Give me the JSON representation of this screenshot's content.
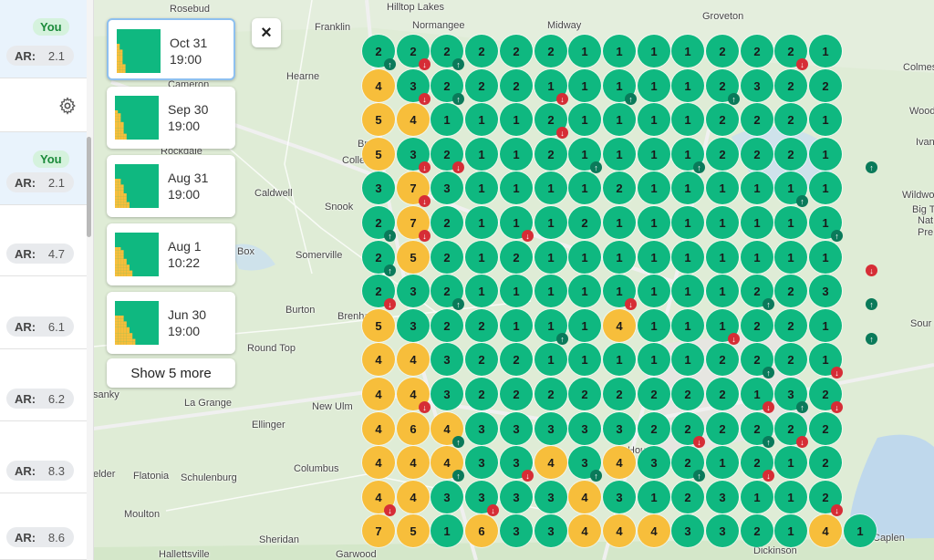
{
  "left_panel": {
    "rows": [
      {
        "you": true,
        "you_label": "You",
        "ar_label": "AR:",
        "ar_value": "2.1"
      },
      {
        "you": false,
        "settings": true
      },
      {
        "you": true,
        "you_label": "You",
        "ar_label": "AR:",
        "ar_value": "2.1"
      },
      {
        "you": false,
        "ar_label": "AR:",
        "ar_value": "4.7"
      },
      {
        "you": false,
        "ar_label": "AR:",
        "ar_value": "6.1"
      },
      {
        "you": false,
        "ar_label": "AR:",
        "ar_value": "6.2"
      },
      {
        "you": false,
        "ar_label": "AR:",
        "ar_value": "8.3"
      },
      {
        "you": false,
        "ar_label": "AR:",
        "ar_value": "8.6"
      }
    ]
  },
  "snapshots": [
    {
      "date": "Oct 31",
      "time": "19:00",
      "selected": true
    },
    {
      "date": "Sep 30",
      "time": "19:00",
      "selected": false
    },
    {
      "date": "Aug 31",
      "time": "19:00",
      "selected": false
    },
    {
      "date": "Aug 1",
      "time": "10:22",
      "selected": false
    },
    {
      "date": "Jun 30",
      "time": "19:00",
      "selected": false
    }
  ],
  "show_more_label": "Show 5 more",
  "close_icon": "×",
  "colors": {
    "good": "#0fb880",
    "mid": "#f7be3b",
    "up": "#0a7a5a",
    "down": "#d62d36"
  },
  "map_places": {
    "rosebud": "Rosebud",
    "hilltop": "Hilltop Lakes",
    "normangee": "Normangee",
    "midway": "Midway",
    "groveton": "Groveton",
    "franklin": "Franklin",
    "hearne": "Hearne",
    "cameron": "Cameron",
    "colmes": "Colmes",
    "wood": "Wood",
    "caldwell": "Caldwell",
    "snook": "Snook",
    "ivanh": "Ivanh",
    "wildwood": "Wildwood",
    "bigt": "Big T",
    "somerville": "Somerville",
    "box": "Box",
    "burton": "Burton",
    "brenham": "Brenha",
    "round_top": "Round Top",
    "sour": "Sour L",
    "sanky": "sanky",
    "la_grange": "La Grange",
    "new_ulm": "New Ulm",
    "ellinger": "Ellinger",
    "elder": "elder",
    "flatonia": "Flatonia",
    "schulenburg": "Schulenburg",
    "columbus": "Columbus",
    "moulton": "Moulton",
    "sheridan": "Sheridan",
    "hallettsville": "Hallettsville",
    "garwood": "Garwood",
    "dickinson": "Dickinson",
    "caplen": "Caplen",
    "rockdale": "Rockdale",
    "colle": "Colle",
    "bry": "Bry",
    "nat": "Nat",
    "pre": "Pre",
    "houston": "Housto"
  },
  "grid": {
    "rows": [
      [
        "2",
        "2",
        "2",
        "2",
        "2",
        "2",
        "1",
        "1",
        "1",
        "1",
        "2",
        "2",
        "2",
        "1"
      ],
      [
        "4",
        "3",
        "2",
        "2",
        "2",
        "1",
        "1",
        "1",
        "1",
        "1",
        "2",
        "3",
        "2",
        "2"
      ],
      [
        "5",
        "4",
        "1",
        "1",
        "1",
        "2",
        "1",
        "1",
        "1",
        "1",
        "2",
        "2",
        "2",
        "1"
      ],
      [
        "5",
        "3",
        "2",
        "1",
        "1",
        "2",
        "1",
        "1",
        "1",
        "1",
        "2",
        "2",
        "2",
        "1"
      ],
      [
        "3",
        "7",
        "3",
        "1",
        "1",
        "1",
        "1",
        "2",
        "1",
        "1",
        "1",
        "1",
        "1",
        "1"
      ],
      [
        "2",
        "7",
        "2",
        "1",
        "1",
        "1",
        "2",
        "1",
        "1",
        "1",
        "1",
        "1",
        "1",
        "1"
      ],
      [
        "2",
        "5",
        "2",
        "1",
        "2",
        "1",
        "1",
        "1",
        "1",
        "1",
        "1",
        "1",
        "1",
        "1"
      ],
      [
        "2",
        "3",
        "2",
        "1",
        "1",
        "1",
        "1",
        "1",
        "1",
        "1",
        "1",
        "2",
        "2",
        "3"
      ],
      [
        "5",
        "3",
        "2",
        "2",
        "1",
        "1",
        "1",
        "4",
        "1",
        "1",
        "1",
        "2",
        "2",
        "1"
      ],
      [
        "4",
        "4",
        "3",
        "2",
        "2",
        "1",
        "1",
        "1",
        "1",
        "1",
        "2",
        "2",
        "2",
        "1"
      ],
      [
        "4",
        "4",
        "3",
        "2",
        "2",
        "2",
        "2",
        "2",
        "2",
        "2",
        "2",
        "1",
        "3",
        "2"
      ],
      [
        "4",
        "6",
        "4",
        "3",
        "3",
        "3",
        "3",
        "3",
        "2",
        "2",
        "2",
        "2",
        "2",
        "2"
      ],
      [
        "4",
        "4",
        "4",
        "3",
        "3",
        "4",
        "3",
        "4",
        "3",
        "2",
        "1",
        "2",
        "1",
        "2"
      ],
      [
        "4",
        "4",
        "3",
        "3",
        "3",
        "3",
        "4",
        "3",
        "1",
        "2",
        "3",
        "1",
        "1",
        "2"
      ],
      [
        "7",
        "5",
        "1",
        "6",
        "3",
        "3",
        "4",
        "4",
        "4",
        "3",
        "3",
        "2",
        "1",
        "4",
        "1"
      ]
    ],
    "arrows": [
      {
        "row": 0,
        "col": 0,
        "dir": "up"
      },
      {
        "row": 0,
        "col": 2,
        "dir": "up"
      },
      {
        "row": 0,
        "col": 1,
        "dir": "dn"
      },
      {
        "row": 0,
        "col": 12,
        "dir": "dn"
      },
      {
        "row": 1,
        "col": 1,
        "dir": "dn"
      },
      {
        "row": 1,
        "col": 2,
        "dir": "up"
      },
      {
        "row": 1,
        "col": 5,
        "dir": "dn"
      },
      {
        "row": 1,
        "col": 7,
        "dir": "up"
      },
      {
        "row": 1,
        "col": 10,
        "dir": "up"
      },
      {
        "row": 2,
        "col": 5,
        "dir": "dn"
      },
      {
        "row": 3,
        "col": 1,
        "dir": "dn"
      },
      {
        "row": 3,
        "col": 2,
        "dir": "dn"
      },
      {
        "row": 3,
        "col": 6,
        "dir": "up"
      },
      {
        "row": 3,
        "col": 9,
        "dir": "up"
      },
      {
        "row": 3,
        "col": 14,
        "dir": "up"
      },
      {
        "row": 4,
        "col": 1,
        "dir": "dn"
      },
      {
        "row": 4,
        "col": 12,
        "dir": "up"
      },
      {
        "row": 5,
        "col": 0,
        "dir": "up"
      },
      {
        "row": 5,
        "col": 1,
        "dir": "dn"
      },
      {
        "row": 5,
        "col": 4,
        "dir": "dn"
      },
      {
        "row": 5,
        "col": 13,
        "dir": "up"
      },
      {
        "row": 6,
        "col": 0,
        "dir": "up"
      },
      {
        "row": 6,
        "col": 14,
        "dir": "dn"
      },
      {
        "row": 7,
        "col": 0,
        "dir": "dn"
      },
      {
        "row": 7,
        "col": 2,
        "dir": "up"
      },
      {
        "row": 7,
        "col": 7,
        "dir": "dn"
      },
      {
        "row": 7,
        "col": 11,
        "dir": "up"
      },
      {
        "row": 7,
        "col": 14,
        "dir": "up"
      },
      {
        "row": 8,
        "col": 5,
        "dir": "up"
      },
      {
        "row": 8,
        "col": 10,
        "dir": "dn"
      },
      {
        "row": 8,
        "col": 14,
        "dir": "up"
      },
      {
        "row": 9,
        "col": 11,
        "dir": "up"
      },
      {
        "row": 9,
        "col": 13,
        "dir": "dn"
      },
      {
        "row": 10,
        "col": 1,
        "dir": "dn"
      },
      {
        "row": 10,
        "col": 11,
        "dir": "dn"
      },
      {
        "row": 10,
        "col": 12,
        "dir": "up"
      },
      {
        "row": 10,
        "col": 13,
        "dir": "dn"
      },
      {
        "row": 11,
        "col": 2,
        "dir": "up"
      },
      {
        "row": 11,
        "col": 9,
        "dir": "dn"
      },
      {
        "row": 11,
        "col": 11,
        "dir": "up"
      },
      {
        "row": 11,
        "col": 12,
        "dir": "dn"
      },
      {
        "row": 12,
        "col": 2,
        "dir": "up"
      },
      {
        "row": 12,
        "col": 4,
        "dir": "dn"
      },
      {
        "row": 12,
        "col": 6,
        "dir": "up"
      },
      {
        "row": 12,
        "col": 9,
        "dir": "up"
      },
      {
        "row": 12,
        "col": 11,
        "dir": "dn"
      },
      {
        "row": 13,
        "col": 0,
        "dir": "dn"
      },
      {
        "row": 13,
        "col": 3,
        "dir": "dn"
      },
      {
        "row": 13,
        "col": 13,
        "dir": "dn"
      }
    ]
  }
}
